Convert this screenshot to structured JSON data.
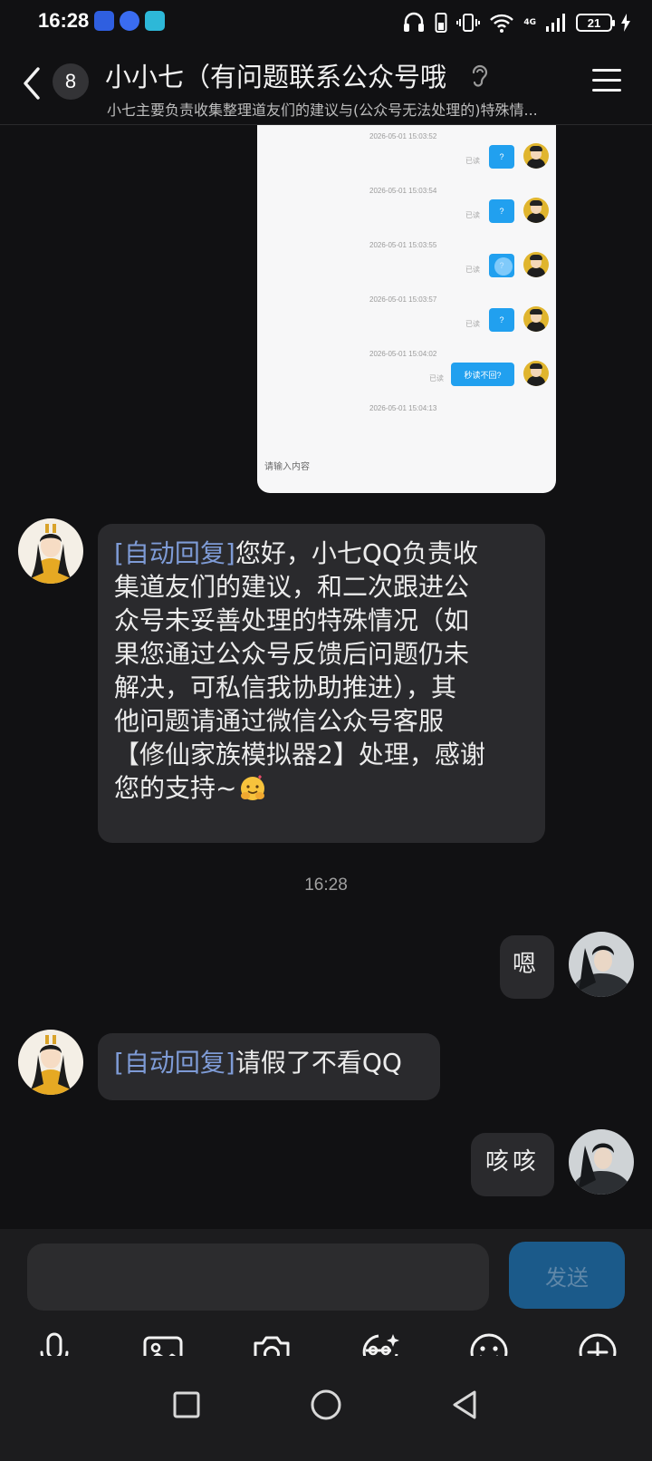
{
  "status_bar": {
    "time": "16:28",
    "network": "4G",
    "battery": "21"
  },
  "header": {
    "unread_count": "8",
    "title": "小小七（有问题联系公众号哦",
    "subtitle": "小七主要负责收集整理道友们的建议与(公众号无法处理的)特殊情..."
  },
  "screenshot_card": {
    "rows": [
      {
        "timestamp": "2026-05-01 15:03:52",
        "read": "已读",
        "text": "?"
      },
      {
        "timestamp": "2026-05-01 15:03:54",
        "read": "已读",
        "text": "?"
      },
      {
        "timestamp": "2026-05-01 15:03:55",
        "read": "已读",
        "text": "?"
      },
      {
        "timestamp": "2026-05-01 15:03:57",
        "read": "已读",
        "text": "?"
      },
      {
        "timestamp": "2026-05-01 15:04:02",
        "read": "已读",
        "text": "秒读不回?"
      }
    ],
    "last_timestamp": "2026-05-01 15:04:13",
    "input_placeholder": "请输入内容"
  },
  "messages": {
    "auto_reply_tag": "[自动回复]",
    "msg1_lines": [
      "您好，小七QQ负责收",
      "集道友们的建议，和二次跟进公",
      "众号未妥善处理的特殊情况（如",
      "果您通过公众号反馈后问题仍未",
      "解决，可私信我协助推进），其",
      "他问题请通过微信公众号客服",
      "【修仙家族模拟器2】处理，感谢",
      "您的支持~"
    ],
    "time_separator": "16:28",
    "msg2": "嗯",
    "msg3": "请假了不看QQ",
    "msg4": "咳咳"
  },
  "input_bar": {
    "send_label": "发送"
  },
  "colors": {
    "background": "#111113",
    "bubble": "#2a2a2d",
    "tag": "#7e9bd6",
    "send": "#1b5a8a"
  },
  "icons": [
    "back-icon",
    "ear-icon",
    "menu-icon",
    "mic-icon",
    "image-icon",
    "camera-icon",
    "sticker-icon",
    "emoji-icon",
    "plus-icon",
    "square-icon",
    "circle-icon",
    "triangle-back-icon"
  ]
}
